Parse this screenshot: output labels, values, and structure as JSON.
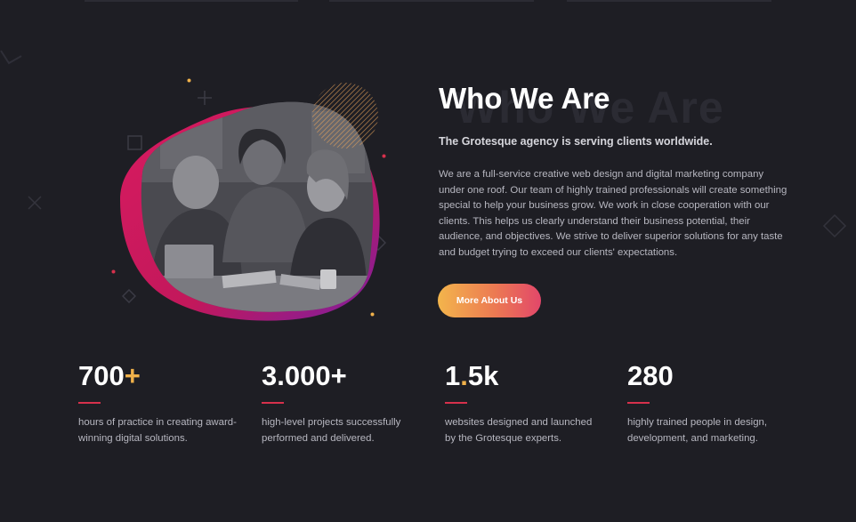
{
  "about": {
    "background_heading": "Who We Are",
    "heading": "Who We Are",
    "subheading": "The Grotesque agency is serving clients worldwide.",
    "body": "We are a full-service creative web design and digital marketing company under one roof. Our team of highly trained professionals will create something special to help your business grow. We work in close cooperation with our clients. This helps us clearly understand their business potential, their audience, and objectives. We strive to deliver superior solutions for any taste and budget trying to exceed our clients' expectations.",
    "cta_label": "More About Us"
  },
  "stats": [
    {
      "value": "700",
      "suffix": "+",
      "description": "hours of practice in creating award-winning digital solutions."
    },
    {
      "value": "3.000+",
      "description": "high-level projects successfully performed and delivered."
    },
    {
      "value_main": "1",
      "value_dot": ".",
      "value_rest": "5k",
      "description": "websites designed and launched by the Grotesque experts."
    },
    {
      "value": "280",
      "description": "highly trained people in design, development, and marketing."
    }
  ],
  "colors": {
    "background": "#1e1e24",
    "accent_orange": "#f0b14a",
    "accent_red": "#d6304c",
    "blob_magenta": "#c2185b",
    "blob_purple": "#7b1fa2",
    "button_gradient": [
      "#f3b54c",
      "#ec7a52",
      "#e2476a"
    ]
  },
  "icons": [
    "team-photo",
    "plus-icon",
    "square-outline-icon",
    "x-icon",
    "diamond-icon",
    "dot-icon",
    "hatched-circle-icon"
  ]
}
